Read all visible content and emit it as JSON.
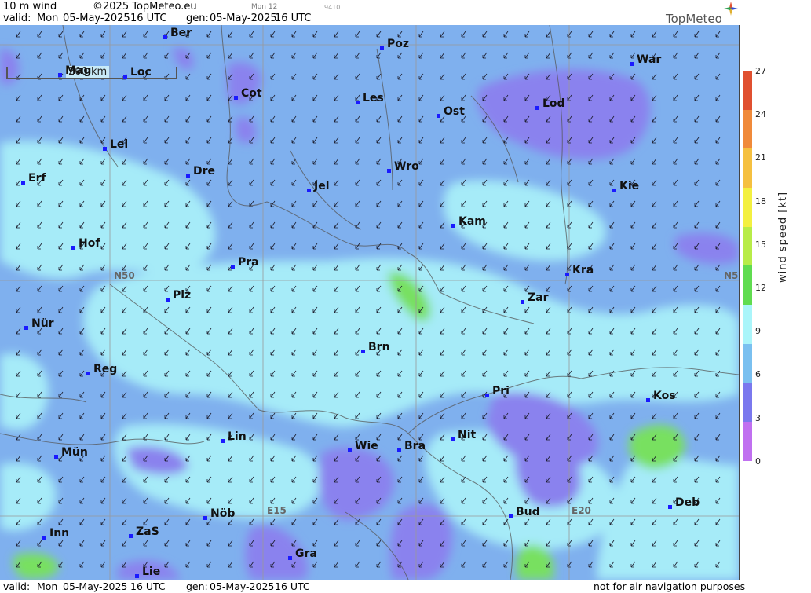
{
  "header": {
    "product": "10 m wind",
    "copyright": "©2025 TopMeteo.eu",
    "valid_label": "valid:",
    "valid_day": "Mon",
    "valid_date": "05-May-2025",
    "valid_time": "16 UTC",
    "gen_label": "gen:",
    "gen_date": "05-May-2025",
    "gen_time": "16 UTC",
    "small1": "Mon 12",
    "small2": "9410",
    "logo": "TopMeteo"
  },
  "footer": {
    "valid_label": "valid:",
    "valid_day": "Mon",
    "valid_date": "05-May-2025",
    "valid_time": "16 UTC",
    "gen_label": "gen:",
    "gen_date": "05-May-2025",
    "gen_time": "16 UTC",
    "disclaimer": "not for air navigation purposes"
  },
  "scale": {
    "label": "200 km"
  },
  "grid_labels": {
    "n50_left": "N50",
    "n50_right": "N5",
    "e15": "E15",
    "e20": "E20"
  },
  "cities": [
    {
      "name": "Ber"
    },
    {
      "name": "Poz"
    },
    {
      "name": "War"
    },
    {
      "name": "Mag"
    },
    {
      "name": "Loc"
    },
    {
      "name": "Cot"
    },
    {
      "name": "Les"
    },
    {
      "name": "Ost"
    },
    {
      "name": "Lod"
    },
    {
      "name": "Lei"
    },
    {
      "name": "Erf"
    },
    {
      "name": "Dre"
    },
    {
      "name": "Wro"
    },
    {
      "name": "Jel"
    },
    {
      "name": "Kie"
    },
    {
      "name": "Kam"
    },
    {
      "name": "Hof"
    },
    {
      "name": "Pra"
    },
    {
      "name": "Kra"
    },
    {
      "name": "Plz"
    },
    {
      "name": "Zar"
    },
    {
      "name": "Nür"
    },
    {
      "name": "Brn"
    },
    {
      "name": "Reg"
    },
    {
      "name": "Pri"
    },
    {
      "name": "Kos"
    },
    {
      "name": "Lin"
    },
    {
      "name": "Nit"
    },
    {
      "name": "Wie"
    },
    {
      "name": "Bra"
    },
    {
      "name": "Mün"
    },
    {
      "name": "Deb"
    },
    {
      "name": "Nöb"
    },
    {
      "name": "Bud"
    },
    {
      "name": "Inn"
    },
    {
      "name": "ZaS"
    },
    {
      "name": "Gra"
    },
    {
      "name": "Lie"
    }
  ],
  "legend": {
    "unit": "wind speed [kt]",
    "ticks": [
      "27",
      "24",
      "21",
      "18",
      "15",
      "12",
      "9",
      "6",
      "3",
      "0"
    ],
    "colors": [
      "#e05030",
      "#f08a3a",
      "#f5c040",
      "#f3f040",
      "#b8ec48",
      "#60dc50",
      "#aaf5fa",
      "#7ac0f0",
      "#7a78ee",
      "#c070f0"
    ]
  },
  "map_colors": {
    "base": "#7fb0ee",
    "low": "#8a82ee",
    "mid": "#a6ebf8",
    "high": "#78e060"
  }
}
